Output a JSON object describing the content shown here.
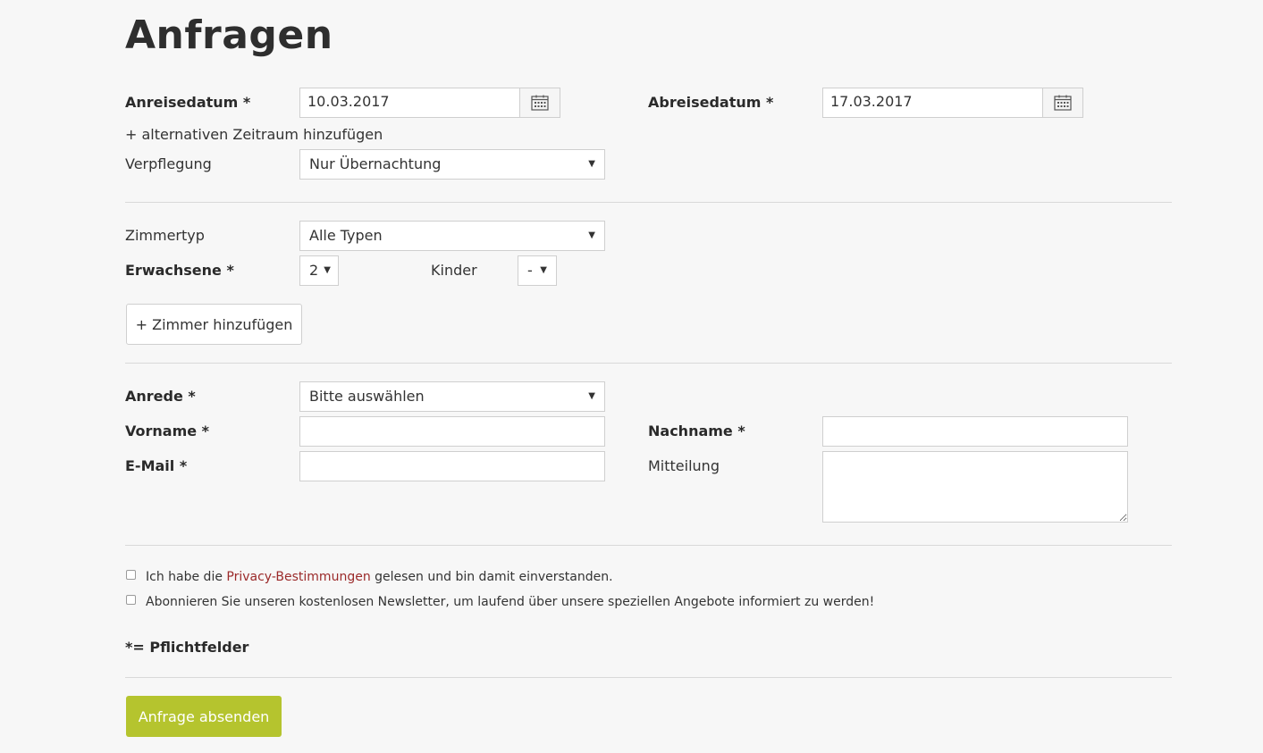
{
  "page_title": "Anfragen",
  "arrival": {
    "label": "Anreisedatum *",
    "value": "10.03.2017",
    "icon": "calendar-icon"
  },
  "departure": {
    "label": "Abreisedatum *",
    "value": "17.03.2017",
    "icon": "calendar-icon"
  },
  "alt_period_link": "+ alternativen Zeitraum hinzufügen",
  "board": {
    "label": "Verpflegung",
    "selected": "Nur Übernachtung"
  },
  "room_type": {
    "label": "Zimmertyp",
    "selected": "Alle Typen"
  },
  "adults": {
    "label": "Erwachsene *",
    "selected": "2"
  },
  "children": {
    "label": "Kinder",
    "selected": "-"
  },
  "add_room_button": "+ Zimmer hinzufügen",
  "salutation": {
    "label": "Anrede *",
    "selected": "Bitte auswählen"
  },
  "first_name": {
    "label": "Vorname *",
    "value": ""
  },
  "last_name": {
    "label": "Nachname *",
    "value": ""
  },
  "email": {
    "label": "E-Mail *",
    "value": ""
  },
  "message": {
    "label": "Mitteilung",
    "value": ""
  },
  "privacy": {
    "prefix": "Ich habe die ",
    "link": "Privacy-Bestimmungen",
    "suffix": " gelesen und bin damit einverstanden.",
    "checked": false
  },
  "newsletter": {
    "text": "Abonnieren Sie unseren kostenlosen Newsletter, um laufend über unsere speziellen Angebote informiert zu werden!",
    "checked": false
  },
  "required_note": "*= Pflichtfelder",
  "submit_button": "Anfrage absenden",
  "colors": {
    "accent": "#b5c42e",
    "link": "#9b2a2a",
    "background": "#f7f7f7"
  }
}
